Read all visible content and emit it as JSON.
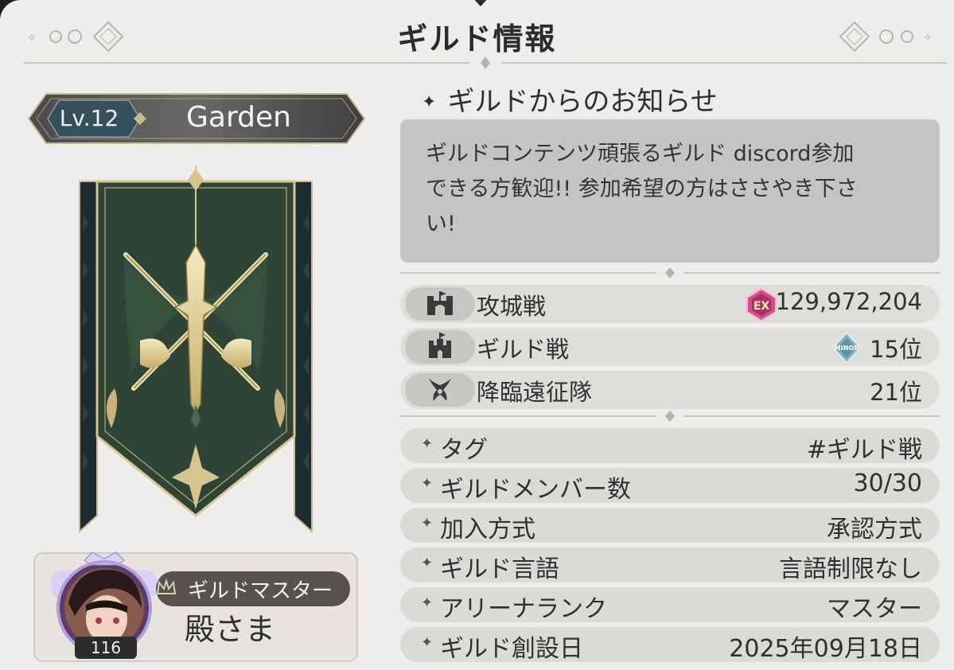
{
  "header": {
    "title": "ギルド情報"
  },
  "guild": {
    "level": "Lv.12",
    "name": "Garden"
  },
  "master": {
    "label": "ギルドマスター",
    "name": "殿さま",
    "level": "116"
  },
  "notice": {
    "heading": "ギルドからのお知らせ",
    "lines": [
      "ギルドコンテンツ頑張るギルド discord参加",
      "できる方歓迎!! 参加希望の方はささやき下さ",
      "い!"
    ]
  },
  "stats": [
    {
      "label": "攻城戦",
      "value": "129,972,204",
      "icon": "siege-castle-icon",
      "badge": "EX"
    },
    {
      "label": "ギルド戦",
      "value": "15位",
      "icon": "guild-war-castle-icon",
      "badge": "MINOR"
    },
    {
      "label": "降臨遠征隊",
      "value": "21位",
      "icon": "descent-expedition-icon",
      "badge": ""
    }
  ],
  "info": [
    {
      "label": "タグ",
      "value": "#ギルド戦"
    },
    {
      "label": "ギルドメンバー数",
      "value": "30/30"
    },
    {
      "label": "加入方式",
      "value": "承認方式"
    },
    {
      "label": "ギルド言語",
      "value": "言語制限なし"
    },
    {
      "label": "アリーナランク",
      "value": "マスター"
    },
    {
      "label": "ギルド創設日",
      "value": "2025年09月18日"
    }
  ],
  "colors": {
    "panel": "#efedeb",
    "banner": "#2d4437",
    "gold": "#d8c48e",
    "levelPlate": "#3b4b52"
  }
}
